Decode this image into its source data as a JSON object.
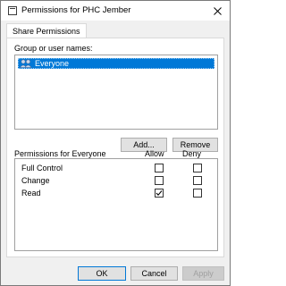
{
  "window": {
    "title": "Permissions for PHC Jember"
  },
  "tabs": [
    {
      "label": "Share Permissions",
      "active": true
    }
  ],
  "groups": {
    "label": "Group or user names:",
    "items": [
      {
        "name": "Everyone",
        "selected": true,
        "icon": "users-group-icon"
      }
    ]
  },
  "buttons": {
    "add": "Add...",
    "remove": "Remove",
    "ok": "OK",
    "cancel": "Cancel",
    "apply": "Apply"
  },
  "permissions": {
    "title": "Permissions for Everyone",
    "allow_header": "Allow",
    "deny_header": "Deny",
    "rows": [
      {
        "name": "Full Control",
        "allow": false,
        "deny": false
      },
      {
        "name": "Change",
        "allow": false,
        "deny": false
      },
      {
        "name": "Read",
        "allow": true,
        "deny": false
      }
    ]
  },
  "colors": {
    "selection": "#0078d7",
    "dialog_bg": "#f0f0f0"
  }
}
